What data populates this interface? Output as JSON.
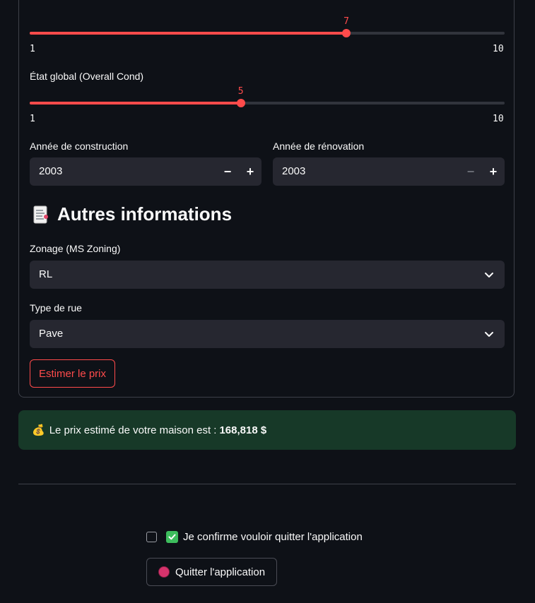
{
  "sliders": [
    {
      "label": "",
      "min": 1,
      "max": 10,
      "value": 7,
      "min_label": "1",
      "max_label": "10",
      "value_label": "7"
    },
    {
      "label": "État global (Overall Cond)",
      "min": 1,
      "max": 10,
      "value": 5,
      "min_label": "1",
      "max_label": "10",
      "value_label": "5"
    }
  ],
  "year_built": {
    "label": "Année de construction",
    "value": "2003",
    "minus": "−",
    "plus": "+"
  },
  "year_remod": {
    "label": "Année de rénovation",
    "value": "2003",
    "minus": "−",
    "plus": "+"
  },
  "section": {
    "icon": "memo-document-icon",
    "title": "Autres informations"
  },
  "zoning": {
    "label": "Zonage (MS Zoning)",
    "value": "RL"
  },
  "street": {
    "label": "Type de rue",
    "value": "Pave"
  },
  "estimate_button": "Estimer le prix",
  "result": {
    "icon": "money-bag-icon",
    "prefix": "💰",
    "message": "Le prix estimé de votre maison est :",
    "amount": "168,818 $"
  },
  "confirm": {
    "checked": false,
    "icon": "check-mark-button-icon",
    "text": "Je confirme vouloir quitter l'application"
  },
  "quit_button": {
    "icon": "stop-sign-icon",
    "label": "Quitter l'application"
  },
  "colors": {
    "accent": "#ff4b4b",
    "background": "#0e1117",
    "input_bg": "#262730",
    "success_bg": "#173928"
  }
}
